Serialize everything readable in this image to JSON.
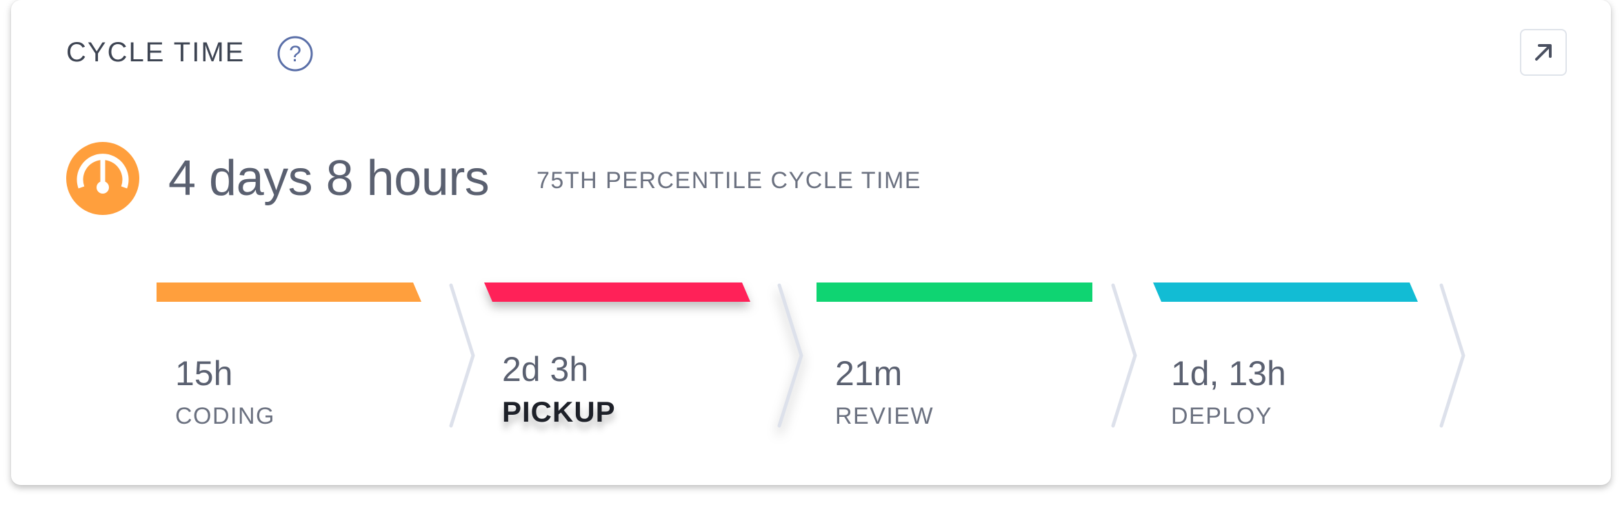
{
  "card": {
    "title": "CYCLE TIME",
    "help_icon": "question-circle-icon",
    "expand_icon": "arrow-up-right-icon"
  },
  "summary": {
    "icon": "gauge-icon",
    "value": "4 days 8 hours",
    "label": "75TH PERCENTILE CYCLE TIME"
  },
  "stages": [
    {
      "value": "15h",
      "label": "CODING",
      "color": "#ff9f3d",
      "active": false
    },
    {
      "value": "2d 3h",
      "label": "PICKUP",
      "color": "#ff2158",
      "active": true
    },
    {
      "value": "21m",
      "label": "REVIEW",
      "color": "#0fd472",
      "active": false
    },
    {
      "value": "1d, 13h",
      "label": "DEPLOY",
      "color": "#12bcd4",
      "active": false
    }
  ],
  "colors": {
    "accent_orange": "#ff9f3d",
    "help_icon": "#5a6fa8",
    "chevron": "#dde1eb"
  }
}
